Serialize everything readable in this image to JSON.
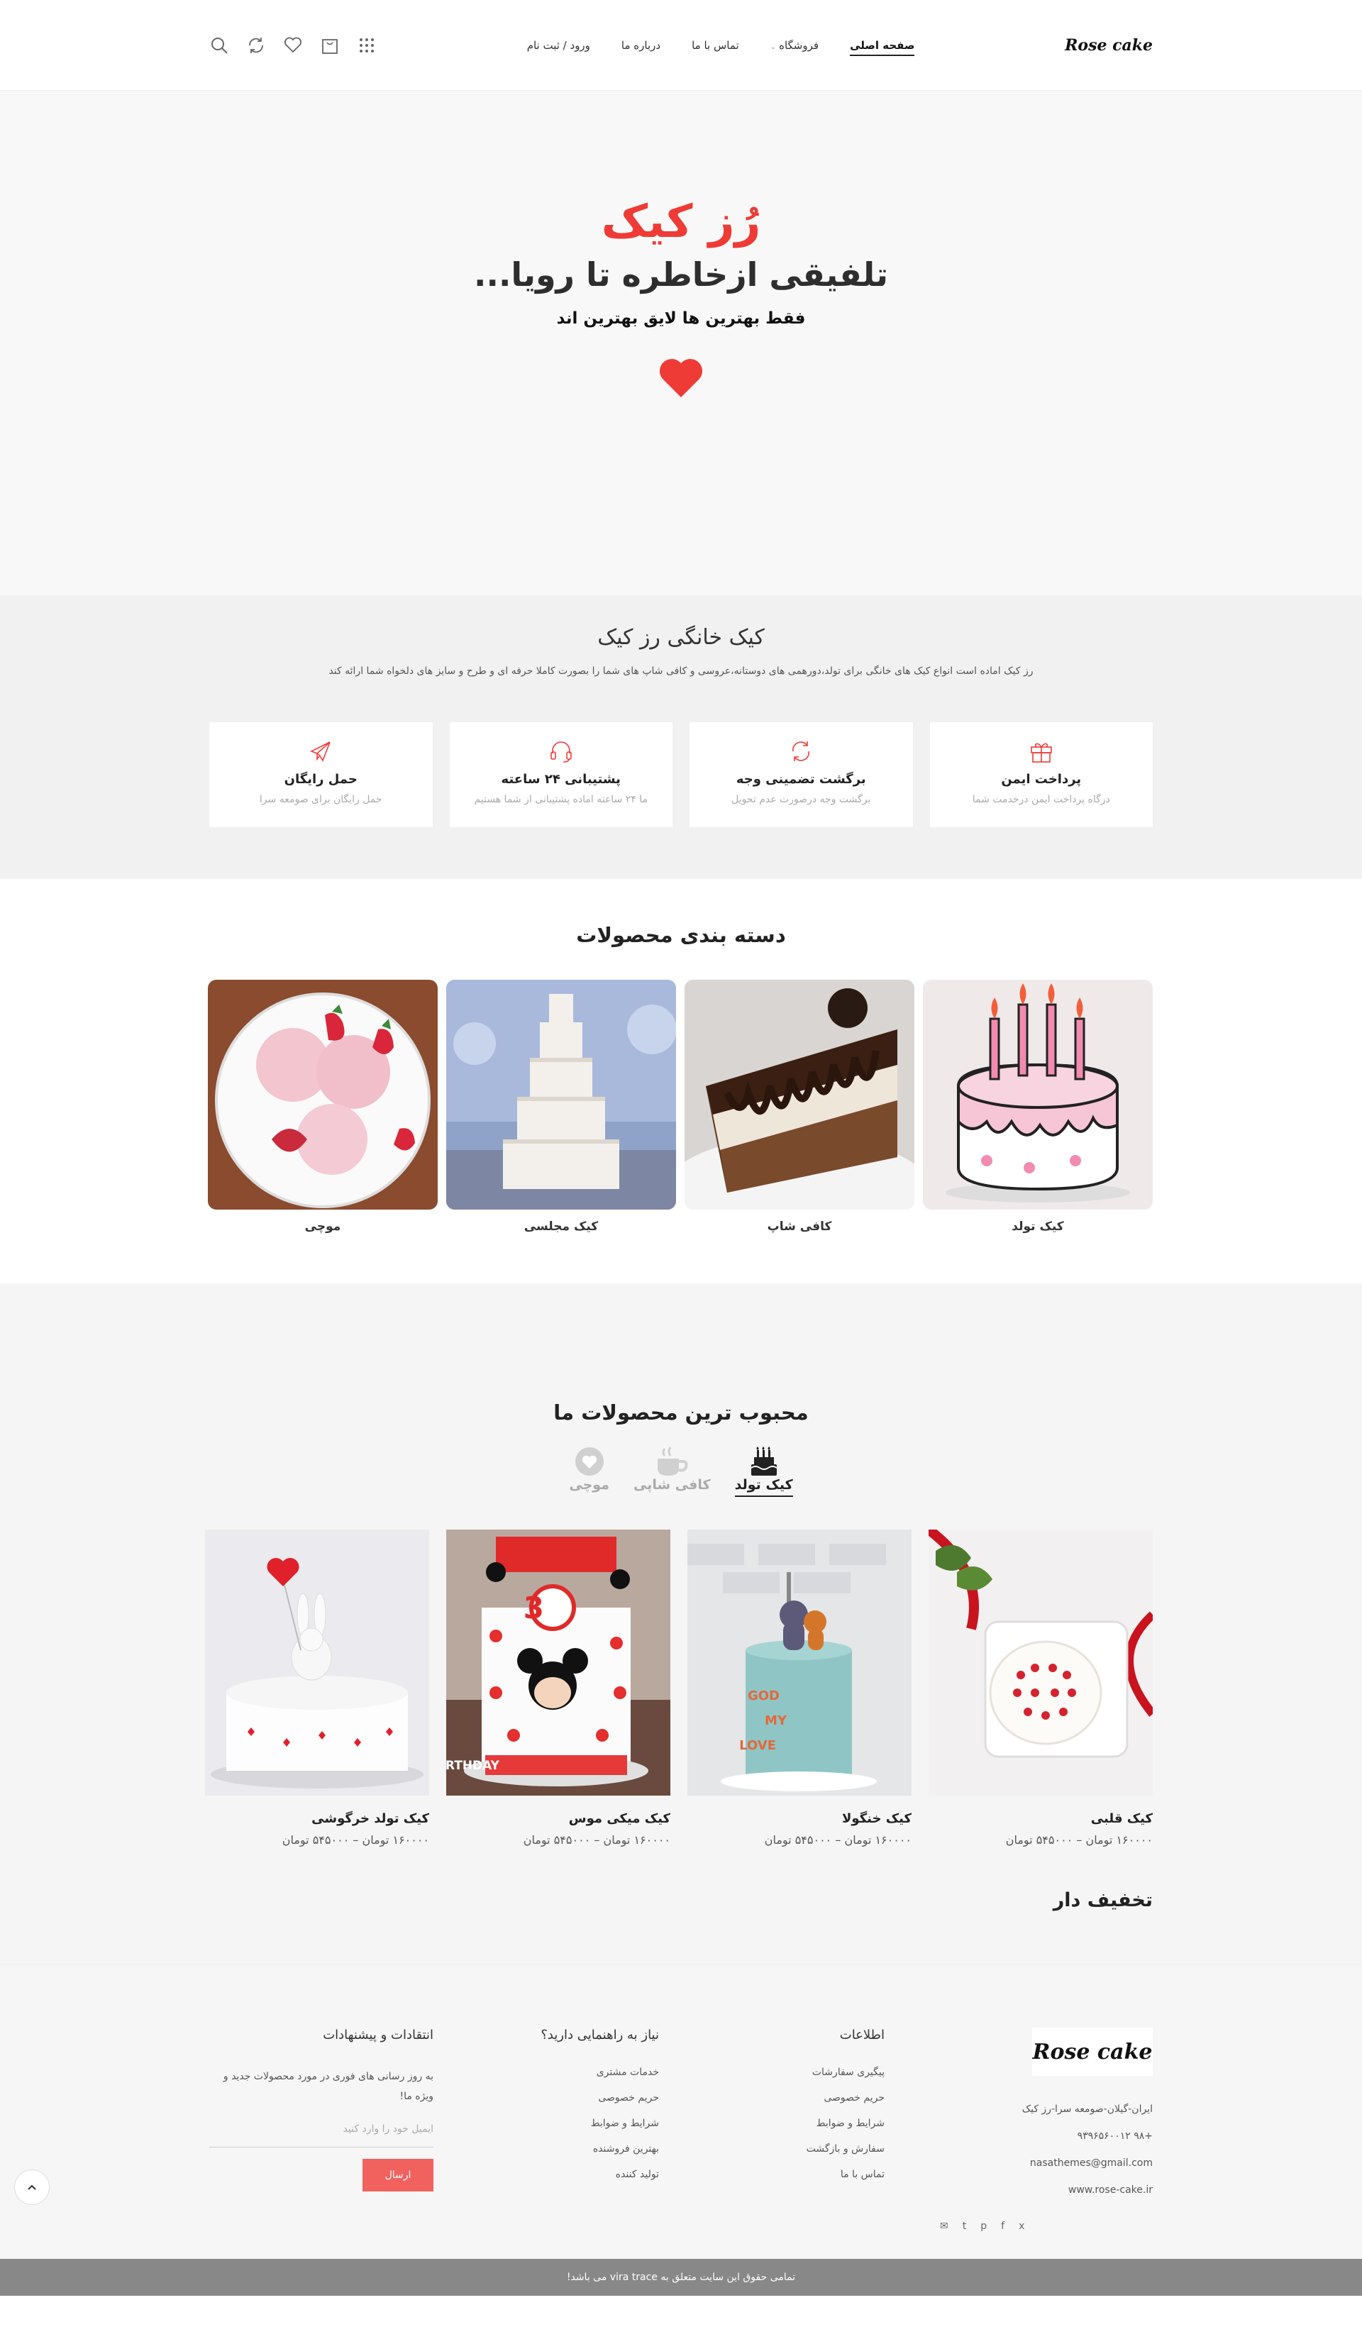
{
  "header": {
    "logo": "Rose cake",
    "nav": [
      "صفحه اصلی",
      "فروشگاه",
      "تماس با ما",
      "درباره ما",
      "ورود / ثبت نام"
    ]
  },
  "hero": {
    "brand": "رُز کیک",
    "tagline": "تلفیقی ازخاطره تا رویا...",
    "subtitle": "فقط بهترین ها لایق بهترین اند"
  },
  "about": {
    "title": "کیک خانگی رز کیک",
    "description": "رز کیک اماده است انواع کیک های خانگی برای تولد،دورهمی های دوستانه،عروسی و کافی شاپ های شما را بصورت کاملا حرفه ای و طرح و سایز های دلخواه شما ارائه کند",
    "features": [
      {
        "title": "پرداخت ایمن",
        "text": "درگاه پرداخت ایمن درخدمت شما",
        "icon": "gift-icon"
      },
      {
        "title": "برگشت تضمینی وجه",
        "text": "برگشت وجه درصورت عدم تحویل",
        "icon": "refresh-icon"
      },
      {
        "title": "پشتیبانی ۲۴ ساعته",
        "text": "ما ۲۴ ساعته اماده پشتیبانی از شما هستیم",
        "icon": "headset-icon"
      },
      {
        "title": "حمل رایگان",
        "text": "حمل رایگان برای صومعه سرا",
        "icon": "plane-icon"
      }
    ]
  },
  "categories": {
    "title": "دسته بندی محصولات",
    "items": [
      "کیک تولد",
      "کافی شاپ",
      "کیک مجلسی",
      "موچی"
    ]
  },
  "popular": {
    "title": "محبوب ترین محصولات ما",
    "tabs": [
      "کیک تولد",
      "کافی شاپی",
      "موچی"
    ],
    "products": [
      {
        "name": "کیک قلبی",
        "price": "۱۶۰۰۰۰ تومان – ۵۴۵۰۰۰ تومان"
      },
      {
        "name": "کیک خنگولا",
        "price": "۱۶۰۰۰۰ تومان – ۵۴۵۰۰۰ تومان"
      },
      {
        "name": "کیک میکی موس",
        "price": "۱۶۰۰۰۰ تومان – ۵۴۵۰۰۰ تومان"
      },
      {
        "name": "کیک تولد خرگوشی",
        "price": "۱۶۰۰۰۰ تومان – ۵۴۵۰۰۰ تومان"
      }
    ],
    "discount_title": "تخفیف دار"
  },
  "footer": {
    "logo": "Rose cake",
    "address": "ایران-گیلان-صومعه سرا-رز کیک",
    "phone": "+۹۸ ۹۳۹۶۵۶۰۰۱۲",
    "email": "nasathemes@gmail.com",
    "website": "www.rose-cake.ir",
    "social": [
      "x",
      "f",
      "p",
      "t",
      "✉"
    ],
    "info_title": "اطلاعات",
    "info_links": [
      "پیگیری سفارشات",
      "حریم خصوصی",
      "شرایط و ضوابط",
      "سفارش و بازگشت",
      "تماس با ما"
    ],
    "help_title": "نیاز به راهنمایی دارید؟",
    "help_links": [
      "خدمات مشتری",
      "حریم خصوصی",
      "شرایط و ضوابط",
      "بهترین فروشنده",
      "تولید کننده"
    ],
    "news_title": "انتقادات و پیشنهادات",
    "news_text": "به روز رسانی های فوری در مورد محصولات جدید و ویژه ما!",
    "email_placeholder": "ایمیل خود را وارد کنید",
    "send": "ارسال",
    "copyright": "تمامی حقوق این سایت متعلق به vira trace می باشد!"
  },
  "colors": {
    "accent": "#ef3b36",
    "button": "#f1625f"
  }
}
